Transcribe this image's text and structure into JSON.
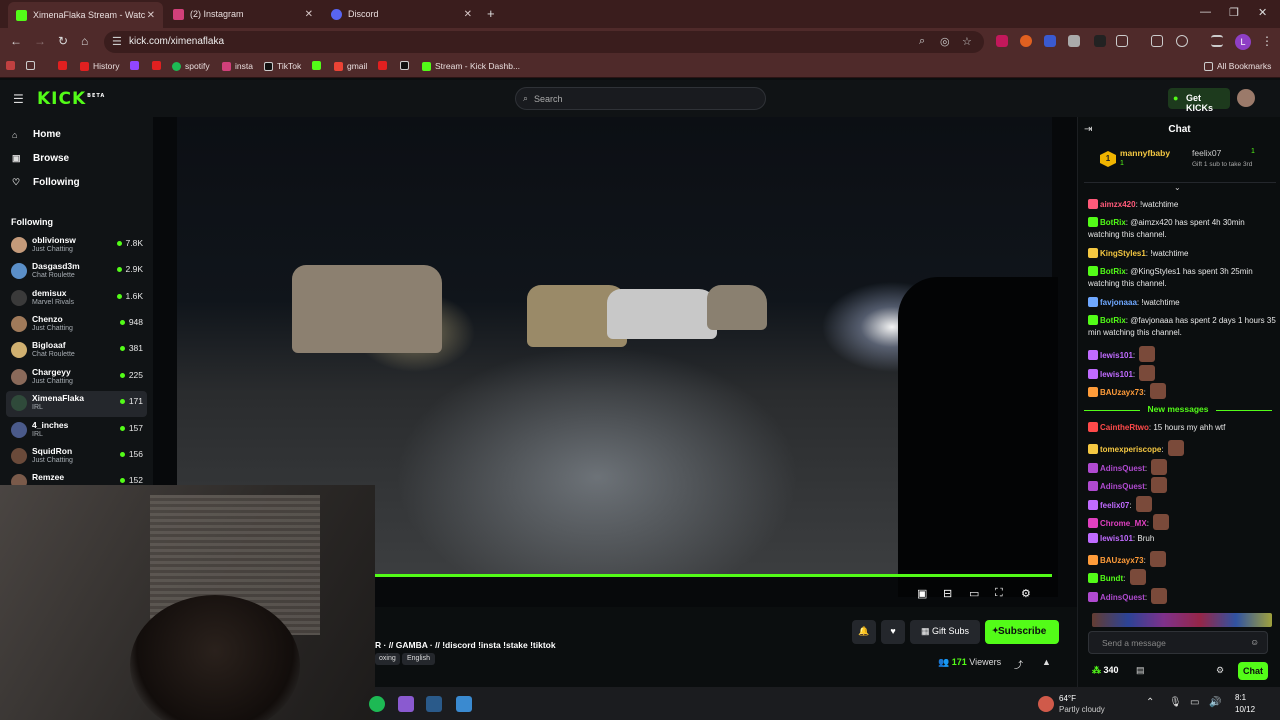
{
  "browser": {
    "tabs": [
      {
        "title": "XimenaFlaka Stream - Watc",
        "active": true
      },
      {
        "title": "(2) Instagram",
        "active": false
      },
      {
        "title": "Discord",
        "active": false
      }
    ],
    "url": "kick.com/ximenaflaka",
    "bookmarks": [
      "History",
      "spotify",
      "insta",
      "TikTok",
      "gmail",
      "Stream - Kick Dashb...",
      "All Bookmarks"
    ],
    "profile_initial": "L"
  },
  "kick": {
    "logo": "KICK",
    "logo_badge": "BETA",
    "search_placeholder": "Search",
    "get_kicks": "Get KICKs"
  },
  "sidebar": {
    "nav": [
      "Home",
      "Browse",
      "Following"
    ],
    "following_heading": "Following",
    "channels": [
      {
        "name": "oblivionsw",
        "category": "Just Chatting",
        "viewers": "7.8K"
      },
      {
        "name": "Dasgasd3m",
        "category": "Chat Roulette",
        "viewers": "2.9K"
      },
      {
        "name": "demisux",
        "category": "Marvel Rivals",
        "viewers": "1.6K"
      },
      {
        "name": "Chenzo",
        "category": "Just Chatting",
        "viewers": "948"
      },
      {
        "name": "Bigloaaf",
        "category": "Chat Roulette",
        "viewers": "381"
      },
      {
        "name": "Chargeyy",
        "category": "Just Chatting",
        "viewers": "225"
      },
      {
        "name": "XimenaFlaka",
        "category": "IRL",
        "viewers": "171"
      },
      {
        "name": "4_inches",
        "category": "IRL",
        "viewers": "157"
      },
      {
        "name": "SquidRon",
        "category": "Just Chatting",
        "viewers": "156"
      },
      {
        "name": "Remzee",
        "category": "",
        "viewers": "152"
      }
    ]
  },
  "stream": {
    "title": "R · // GAMBA ·  // !discord !insta !stake  !tiktok",
    "category_tag": "oxing",
    "language_tag": "English",
    "gift_subs": "Gift Subs",
    "subscribe": "Subscribe",
    "viewers_count": "171",
    "viewers_label": "Viewers"
  },
  "chat": {
    "title": "Chat",
    "pinned": {
      "rank": "1",
      "user1": "mannyfbaby",
      "user1_count": "1",
      "user2": "feelix07",
      "user2_count": "1",
      "note": "Gift 1 sub to take 3rd"
    },
    "messages": [
      {
        "user": "aimzx420",
        "text": "!watchtime",
        "color": "#ff5a7a"
      },
      {
        "user": "BotRix",
        "text": "@aimzx420 has spent 4h 30min watching this channel.",
        "color": "#53fc18"
      },
      {
        "user": "KingStyles1",
        "text": "!watchtime",
        "color": "#f5c842"
      },
      {
        "user": "BotRix",
        "text": "@KingStyles1 has spent 3h 25min watching this channel.",
        "color": "#53fc18"
      },
      {
        "user": "favjonaaa",
        "text": "!watchtime",
        "color": "#6fa8ff"
      },
      {
        "user": "BotRix",
        "text": "@favjonaaa has spent 2 days 1 hours 35 min watching this channel.",
        "color": "#53fc18"
      },
      {
        "user": "lewis101",
        "text": "",
        "color": "#c06bff"
      },
      {
        "user": "lewis101",
        "text": "",
        "color": "#c06bff"
      },
      {
        "user": "BAUzayx73",
        "text": "",
        "color": "#ff9c3a"
      }
    ],
    "new_messages_label": "New messages",
    "messages_after": [
      {
        "user": "CaintheRtwo",
        "text": "15 hours my ahh wtf",
        "color": "#ff4a4a"
      },
      {
        "user": "tomexperiscope",
        "text": "",
        "color": "#f5c842"
      },
      {
        "user": "AdinsQuest",
        "text": "",
        "color": "#b04ad0"
      },
      {
        "user": "AdinsQuest",
        "text": "",
        "color": "#b04ad0"
      },
      {
        "user": "feelix07",
        "text": "",
        "color": "#c06bff"
      },
      {
        "user": "Chrome_MX",
        "text": "",
        "color": "#e040c0"
      },
      {
        "user": "lewis101",
        "text": "Bruh",
        "color": "#c06bff"
      },
      {
        "user": "BAUzayx73",
        "text": "",
        "color": "#ff9c3a"
      },
      {
        "user": "Bundt",
        "text": "",
        "color": "#53fc18"
      },
      {
        "user": "AdinsQuest",
        "text": "",
        "color": "#b04ad0"
      }
    ],
    "input_placeholder": "Send a message",
    "points": "340",
    "send_label": "Chat"
  },
  "taskbar": {
    "temperature": "64°F",
    "condition": "Partly cloudy",
    "time": "8:1",
    "date": "10/12"
  },
  "colors": {
    "kick_green": "#53fc18",
    "browser_frame": "#4f2a2a"
  }
}
